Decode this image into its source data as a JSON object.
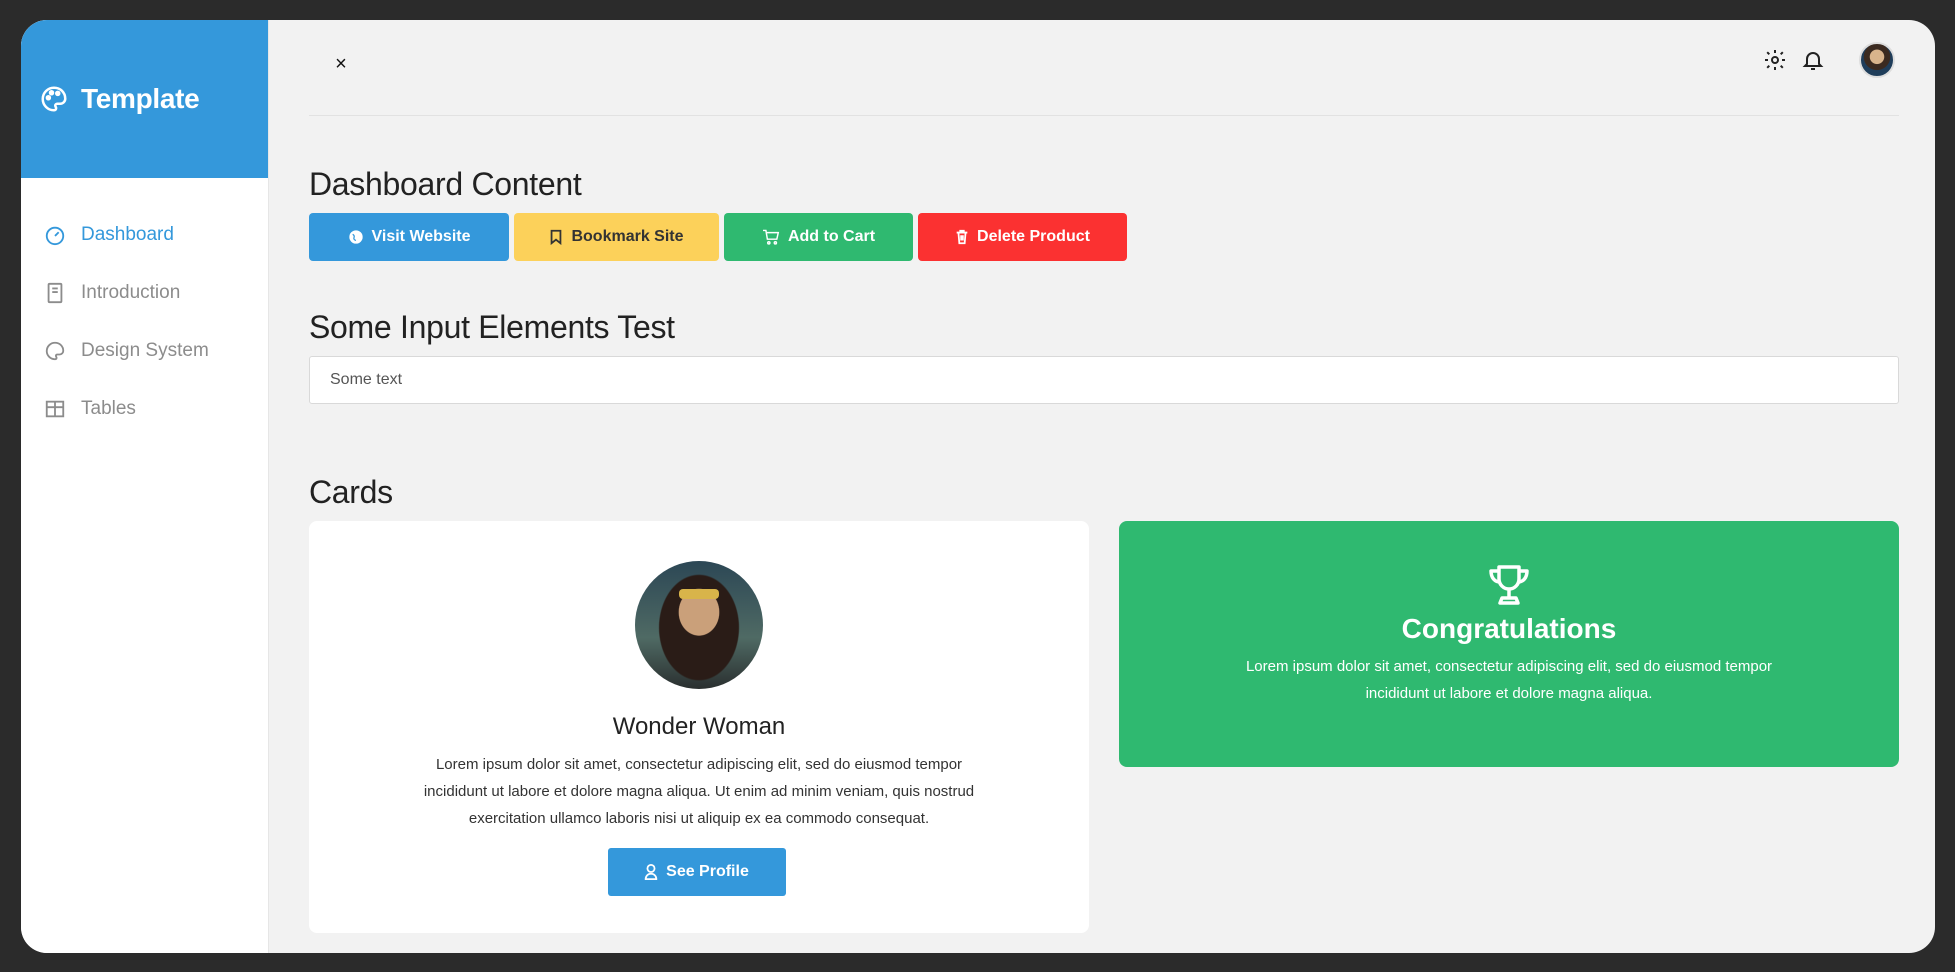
{
  "sidebar": {
    "brand": "Template",
    "items": [
      {
        "label": "Dashboard",
        "icon": "gauge-icon",
        "active": true
      },
      {
        "label": "Introduction",
        "icon": "book-icon",
        "active": false
      },
      {
        "label": "Design System",
        "icon": "palette-icon",
        "active": false
      },
      {
        "label": "Tables",
        "icon": "table-icon",
        "active": false
      }
    ]
  },
  "header": {
    "close_symbol": "×",
    "icons": [
      "gear-icon",
      "bell-icon"
    ]
  },
  "main": {
    "section1_title": "Dashboard Content",
    "buttons": {
      "visit": "Visit Website",
      "bookmark": "Bookmark Site",
      "cart": "Add to Cart",
      "delete": "Delete Product"
    },
    "section2_title": "Some Input Elements Test",
    "input": {
      "value": "Some text"
    },
    "section3_title": "Cards",
    "profile_card": {
      "name": "Wonder Woman",
      "text": "Lorem ipsum dolor sit amet, consectetur adipiscing elit, sed do eiusmod tempor incididunt ut labore et dolore magna aliqua. Ut enim ad minim veniam, quis nostrud exercitation ullamco laboris nisi ut aliquip ex ea commodo consequat.",
      "button": "See Profile"
    },
    "congrats_card": {
      "title": "Congratulations",
      "text": "Lorem ipsum dolor sit amet, consectetur adipiscing elit, sed do eiusmod tempor incididunt ut labore et dolore magna aliqua."
    }
  },
  "colors": {
    "primary": "#3498db",
    "warning": "#fcd15a",
    "success": "#2fb970",
    "danger": "#fb3131"
  }
}
